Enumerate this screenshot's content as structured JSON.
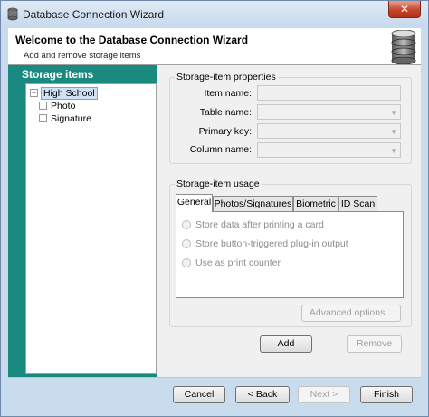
{
  "window": {
    "title": "Database Connection Wizard",
    "close_label": "✕"
  },
  "header": {
    "title": "Welcome to the Database Connection Wizard",
    "subtitle": "Add and remove storage items"
  },
  "storage": {
    "title": "Storage items",
    "tree": [
      {
        "label": "High School",
        "expander": "−",
        "selected": true
      },
      {
        "label": "Photo",
        "expander": ""
      },
      {
        "label": "Signature",
        "expander": ""
      }
    ]
  },
  "properties": {
    "title": "Storage-item properties",
    "item_name_label": "Item name:",
    "table_name_label": "Table name:",
    "primary_key_label": "Primary key:",
    "column_name_label": "Column name:"
  },
  "usage": {
    "title": "Storage-item usage",
    "tabs": [
      "General",
      "Photos/Signatures",
      "Biometric",
      "ID Scan"
    ],
    "options": [
      "Store data after printing a card",
      "Store button-triggered plug-in output",
      "Use as print counter"
    ],
    "advanced_label": "Advanced options..."
  },
  "actions": {
    "add_label": "Add",
    "remove_label": "Remove"
  },
  "footer": {
    "cancel_label": "Cancel",
    "back_label": "< Back",
    "next_label": "Next >",
    "finish_label": "Finish"
  }
}
